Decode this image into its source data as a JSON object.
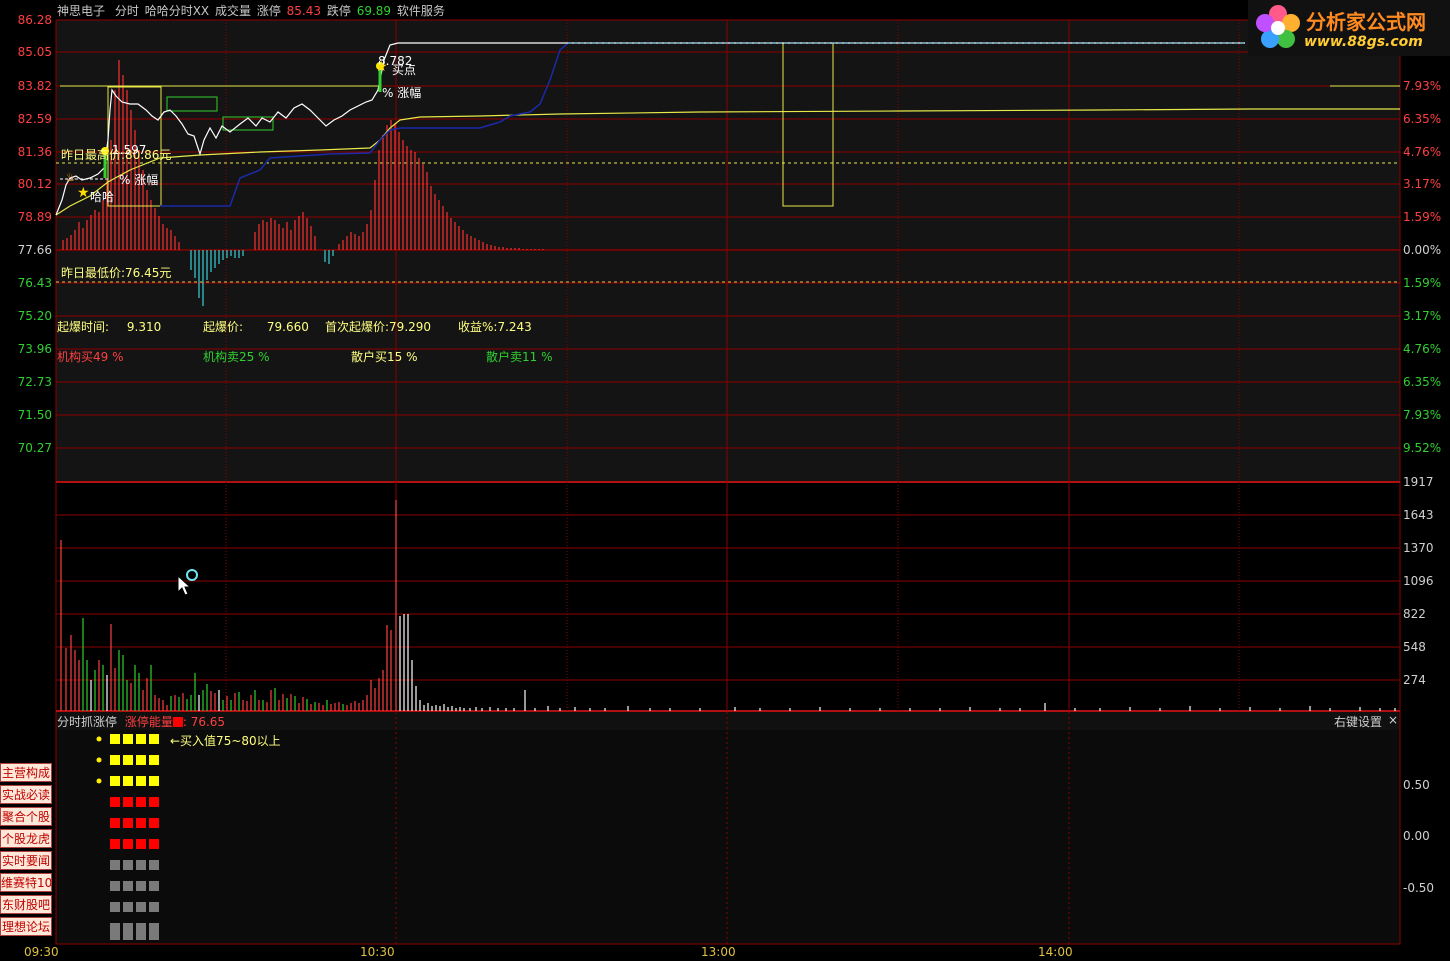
{
  "header": {
    "stock_name": "神思电子",
    "mode": "分时",
    "indicator": "哈哈分时XX",
    "volume_label": "成交量",
    "limit_up_label": "涨停",
    "limit_up_value": "85.43",
    "limit_down_label": "跌停",
    "limit_down_value": "69.89",
    "service_label": "软件服务"
  },
  "logo": {
    "text": "分析家公式网",
    "url": "www.88gs.com"
  },
  "price_axis": [
    "86.28",
    "85.05",
    "83.82",
    "82.59",
    "81.36",
    "80.12",
    "78.89",
    "77.66",
    "76.43",
    "75.20",
    "73.96",
    "72.73",
    "71.50",
    "70.27"
  ],
  "pct_axis": [
    "7.93%",
    "6.35%",
    "4.76%",
    "3.17%",
    "1.59%",
    "0.00%",
    "1.59%",
    "3.17%",
    "4.76%",
    "6.35%",
    "7.93%",
    "9.52%"
  ],
  "volume_axis": [
    "1917",
    "1643",
    "1370",
    "1096",
    "822",
    "548",
    "274"
  ],
  "indicator_axis": [
    "0.50",
    "0.00",
    "-0.50"
  ],
  "time_axis": [
    "09:30",
    "10:30",
    "13:00",
    "14:00"
  ],
  "annotations": {
    "yesterday_high": "昨日最高价:80.86元",
    "yesterday_low": "昨日最低价:76.45元",
    "rise_label_1": "涨幅",
    "rise_label_2": "涨幅",
    "buy_point": "买点",
    "haha_label": "哈哈",
    "value_1": "1.597",
    "value_2": "8.782"
  },
  "stats": {
    "burst_time_label": "起爆时间:",
    "burst_time_value": "9.310",
    "burst_price_label": "起爆价:",
    "burst_price_value": "79.660",
    "first_burst_label": "首次起爆价:",
    "first_burst_value": "79.290",
    "profit_label": "收益%:",
    "profit_value": "7.243"
  },
  "flows": {
    "inst_buy": "机构买49 %",
    "inst_sell": "机构卖25 %",
    "retail_buy": "散户买15 %",
    "retail_sell": "散户卖11 %"
  },
  "indicator_panel": {
    "name": "分时抓涨停",
    "energy_label": "涨停能量",
    "energy_value": ": 76.65",
    "buy_hint": "←买入值75~80以上",
    "right_settings": "右键设置",
    "close": "×"
  },
  "side_links": [
    "主营构成",
    "实战必读",
    "聚合个股",
    "个股龙虎",
    "实时要闻",
    "维赛特10",
    "东财股吧",
    "理想论坛"
  ],
  "colors": {
    "grid": "#8b0000",
    "price_line": "#ffffff",
    "avg_line": "#e8e84a",
    "blue_line": "#1a2aa8",
    "up": "#ff3030",
    "down": "#3ad0d8",
    "green": "#30d030",
    "yellow_box": "#ffff00",
    "red_box": "#ff0000",
    "gray_box": "#7a7a7a"
  }
}
